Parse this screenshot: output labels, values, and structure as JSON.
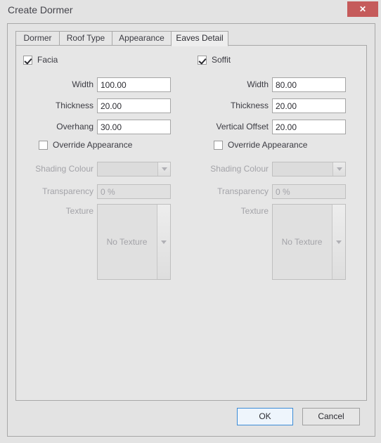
{
  "window": {
    "title": "Create Dormer",
    "close_label": "✕",
    "close_icon": "close-icon",
    "close_color": "#c55b5b"
  },
  "tabs": [
    {
      "label": "Dormer",
      "active": false
    },
    {
      "label": "Roof Type",
      "active": false
    },
    {
      "label": "Appearance",
      "active": false
    },
    {
      "label": "Eaves Detail",
      "active": true
    }
  ],
  "panel": {
    "left": {
      "group_label": "Facia",
      "group_checked": true,
      "fields": [
        {
          "label": "Width",
          "value": "100.00"
        },
        {
          "label": "Thickness",
          "value": "20.00"
        },
        {
          "label": "Overhang",
          "value": "30.00"
        }
      ],
      "override": {
        "label": "Override Appearance",
        "checked": false,
        "shading_colour_label": "Shading Colour",
        "shading_colour_value": "",
        "transparency_label": "Transparency",
        "transparency_value": "0 %",
        "texture_label": "Texture",
        "texture_value": "No Texture"
      }
    },
    "right": {
      "group_label": "Soffit",
      "group_checked": true,
      "fields": [
        {
          "label": "Width",
          "value": "80.00"
        },
        {
          "label": "Thickness",
          "value": "20.00"
        },
        {
          "label": "Vertical Offset",
          "value": "20.00"
        }
      ],
      "override": {
        "label": "Override Appearance",
        "checked": false,
        "shading_colour_label": "Shading Colour",
        "shading_colour_value": "",
        "transparency_label": "Transparency",
        "transparency_value": "0 %",
        "texture_label": "Texture",
        "texture_value": "No Texture"
      }
    }
  },
  "footer": {
    "ok_label": "OK",
    "cancel_label": "Cancel"
  },
  "colors": {
    "background": "#e3e3e3",
    "panel": "#e6e6e6",
    "border": "#a8a8a8",
    "accent": "#3c8bd6",
    "close": "#c55b5b",
    "disabled_text": "#a3a3a8"
  }
}
